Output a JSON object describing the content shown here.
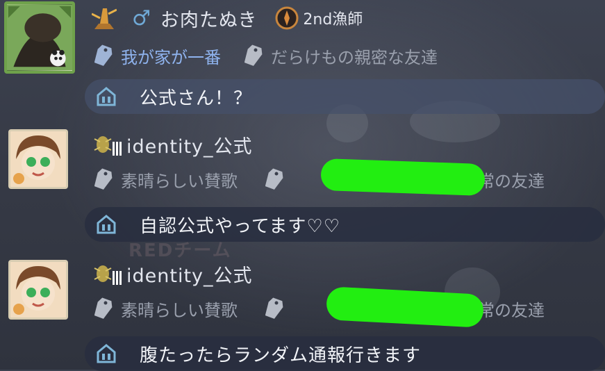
{
  "messages": [
    {
      "user": "お肉たぬき",
      "gender_icon": "male-symbol",
      "rank": "2nd漁師",
      "tags": [
        "我が家が一番",
        "だらけもの親密な友達"
      ],
      "text": "公式さん！？"
    },
    {
      "user": "identity_公式",
      "tags": [
        "素晴らしい賛歌",
        "の通常の友達"
      ],
      "text": "自認公式やってます♡♡"
    },
    {
      "user": "identity_公式",
      "tags": [
        "素晴らしい賛歌",
        "の通常の友達"
      ],
      "text": "腹たったらランダム通報行きます"
    }
  ],
  "background_text": "REDチーム",
  "colors": {
    "redaction": "#22ee11",
    "highlight_tag": "#8fb3ee",
    "bubble_icon": "#7fb6d8",
    "male_symbol": "#6fa9d6"
  },
  "icons": [
    "lighthouse-icon",
    "rank-emblem-icon",
    "bug-badge-icon",
    "tag-icon",
    "chat-channel-icon"
  ]
}
